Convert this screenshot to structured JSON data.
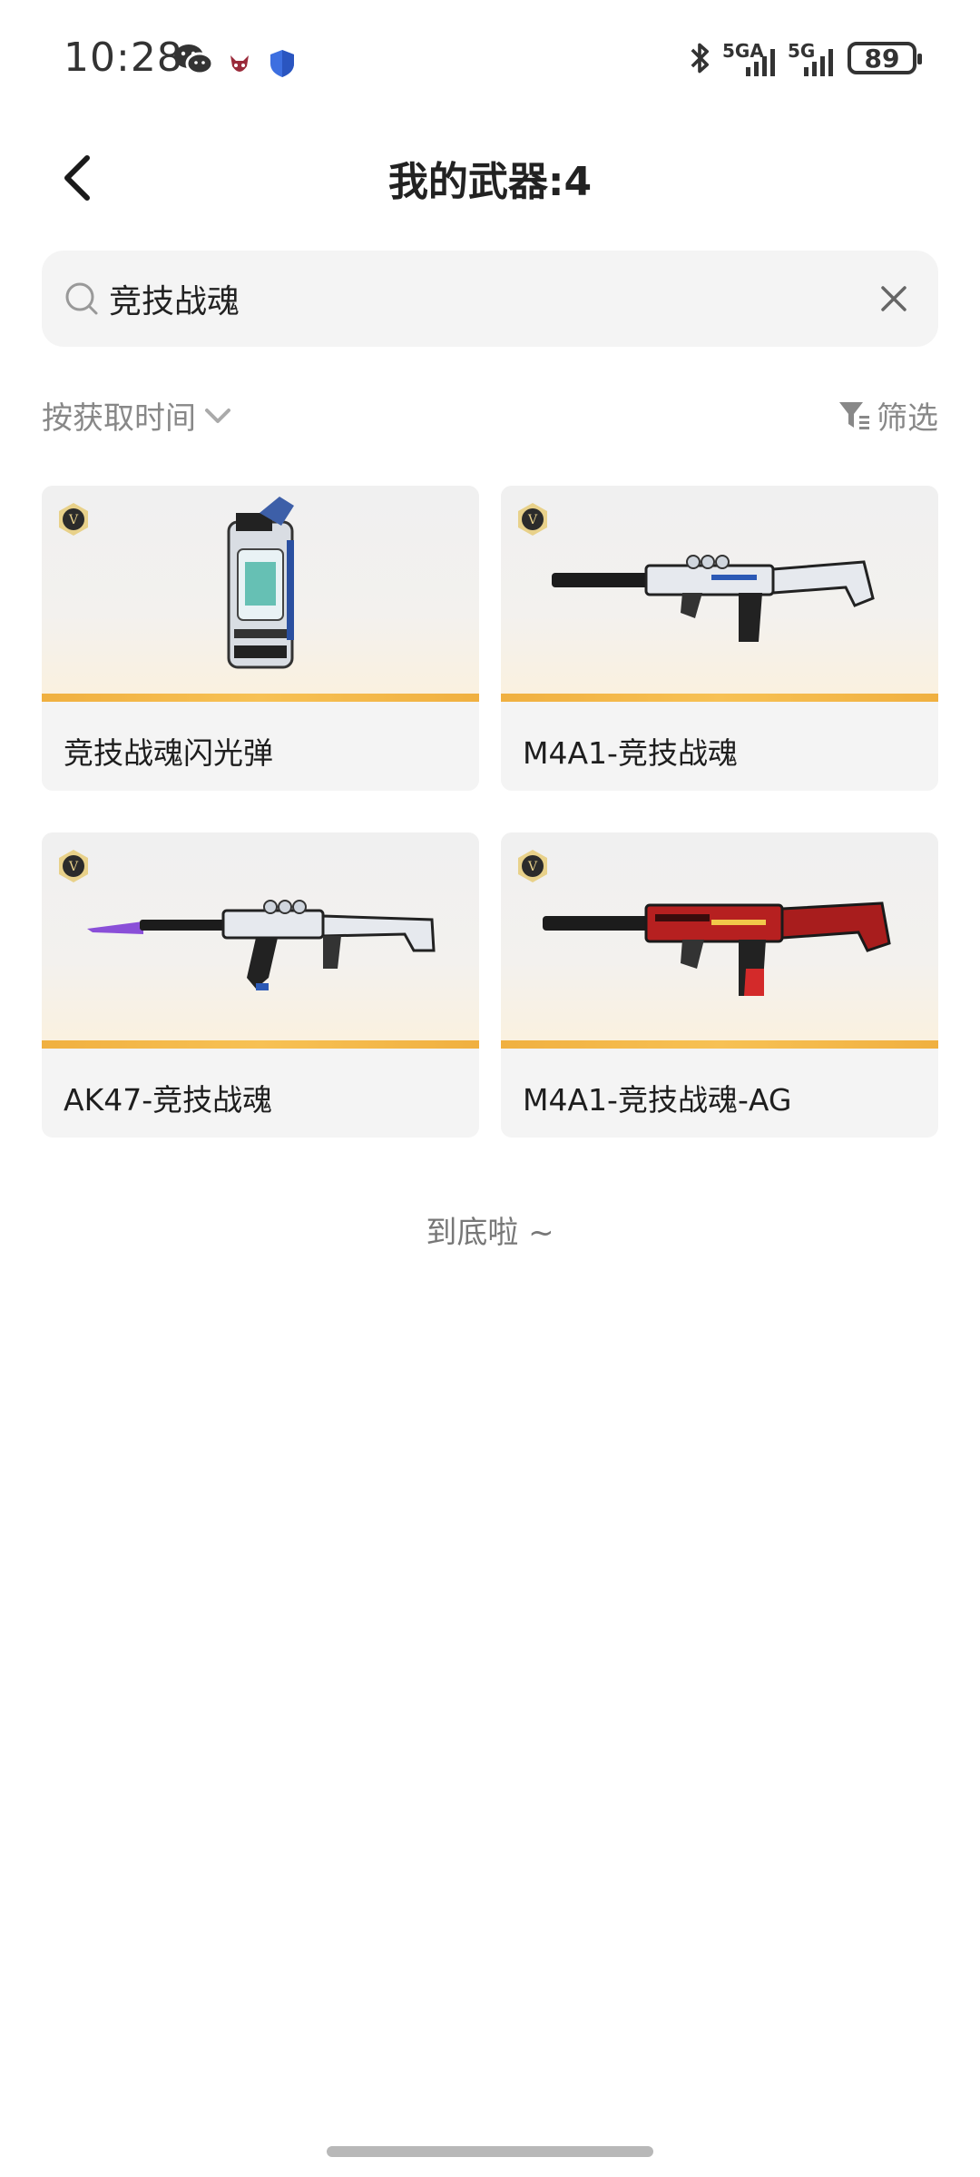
{
  "status_bar": {
    "time": "10:28",
    "network1": "5GA",
    "network2": "5G",
    "battery": "89"
  },
  "header": {
    "title": "我的武器:4"
  },
  "search": {
    "value": "竞技战魂"
  },
  "sort": {
    "label": "按获取时间"
  },
  "filter": {
    "label": "筛选"
  },
  "items": [
    {
      "name": "竞技战魂闪光弹",
      "icon": "flashbang-grenade-icon"
    },
    {
      "name": "M4A1-竞技战魂",
      "icon": "rifle-white-icon"
    },
    {
      "name": "AK47-竞技战魂",
      "icon": "rifle-white-bayonet-icon"
    },
    {
      "name": "M4A1-竞技战魂-AG",
      "icon": "rifle-red-icon"
    }
  ],
  "footer": {
    "end_text": "到底啦 ~"
  },
  "colors": {
    "accent_bar": "#f0b040",
    "card_bg": "#f4f4f4",
    "secondary_text": "#888888"
  }
}
